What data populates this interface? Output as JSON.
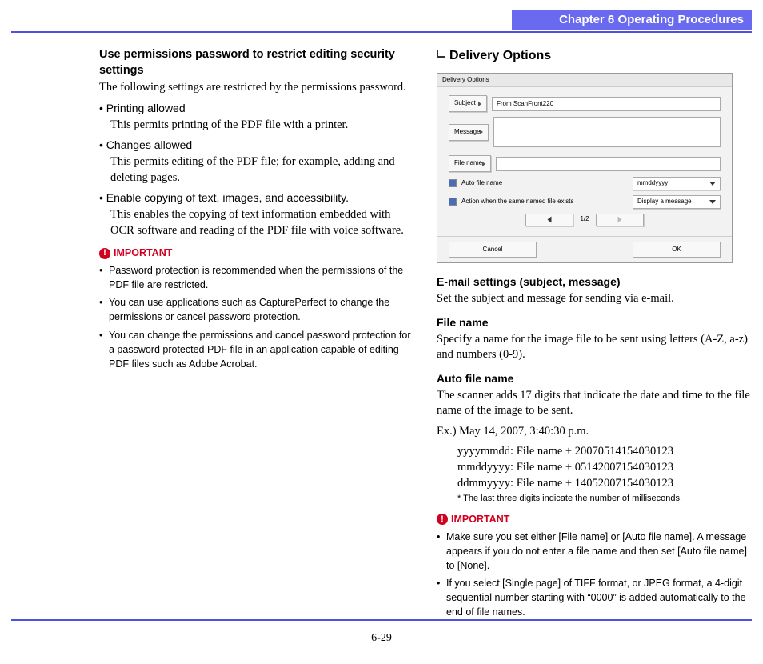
{
  "header": {
    "chapter": "Chapter 6   Operating Procedures"
  },
  "left": {
    "heading": "Use permissions password to restrict editing security settings",
    "intro": "The following settings are restricted by the permissions password.",
    "b1_label": "Printing allowed",
    "b1_desc": "This permits printing of the PDF file with a printer.",
    "b2_label": "Changes allowed",
    "b2_desc": "This permits editing of the PDF file; for example, adding and deleting pages.",
    "b3_label": "Enable copying of text, images, and accessibility.",
    "b3_desc": "This enables the copying of text information embedded with OCR software and reading of the PDF file with voice software.",
    "important_label": "IMPORTANT",
    "n1": "Password protection is recommended when the permissions of the PDF file are restricted.",
    "n2": "You can use applications such as CapturePerfect to change the permissions or cancel password protection.",
    "n3": "You can change the permissions and cancel password protection for a password protected PDF file in an application capable of editing PDF files such as Adobe Acrobat."
  },
  "right": {
    "section_title": "Delivery Options",
    "ss": {
      "title": "Delivery Options",
      "subject_btn": "Subject",
      "subject_val": "From ScanFront220",
      "message_btn": "Message",
      "filename_btn": "File name",
      "auto_label": "Auto file name",
      "auto_val": "mmddyyyy",
      "action_label": "Action when the same named file exists",
      "action_val": "Display a message",
      "page": "1/2",
      "cancel": "Cancel",
      "ok": "OK"
    },
    "email_heading": "E-mail settings (subject, message)",
    "email_desc": "Set the subject and message for sending via e-mail.",
    "filename_heading": "File name",
    "filename_desc": "Specify a name for the image file to be sent using letters (A-Z, a-z) and numbers (0-9).",
    "auto_heading": "Auto file name",
    "auto_desc": "The scanner adds 17 digits that indicate the date and time to the file name of the image to be sent.",
    "ex_line": "Ex.) May 14, 2007, 3:40:30 p.m.",
    "ex1": "yyyymmdd: File name + 20070514154030123",
    "ex2": "mmddyyyy: File name + 05142007154030123",
    "ex3": "ddmmyyyy: File name + 14052007154030123",
    "ex_note": "* The last three digits indicate the number of milliseconds.",
    "important_label": "IMPORTANT",
    "rn1": "Make sure you set either [File name] or [Auto file name]. A message appears if you do not enter a file name and then set [Auto file name] to [None].",
    "rn2": "If you select [Single page] of TIFF format, or JPEG format, a 4-digit sequential number starting with “0000” is added automatically to the end of file names."
  },
  "page_number": "6-29"
}
